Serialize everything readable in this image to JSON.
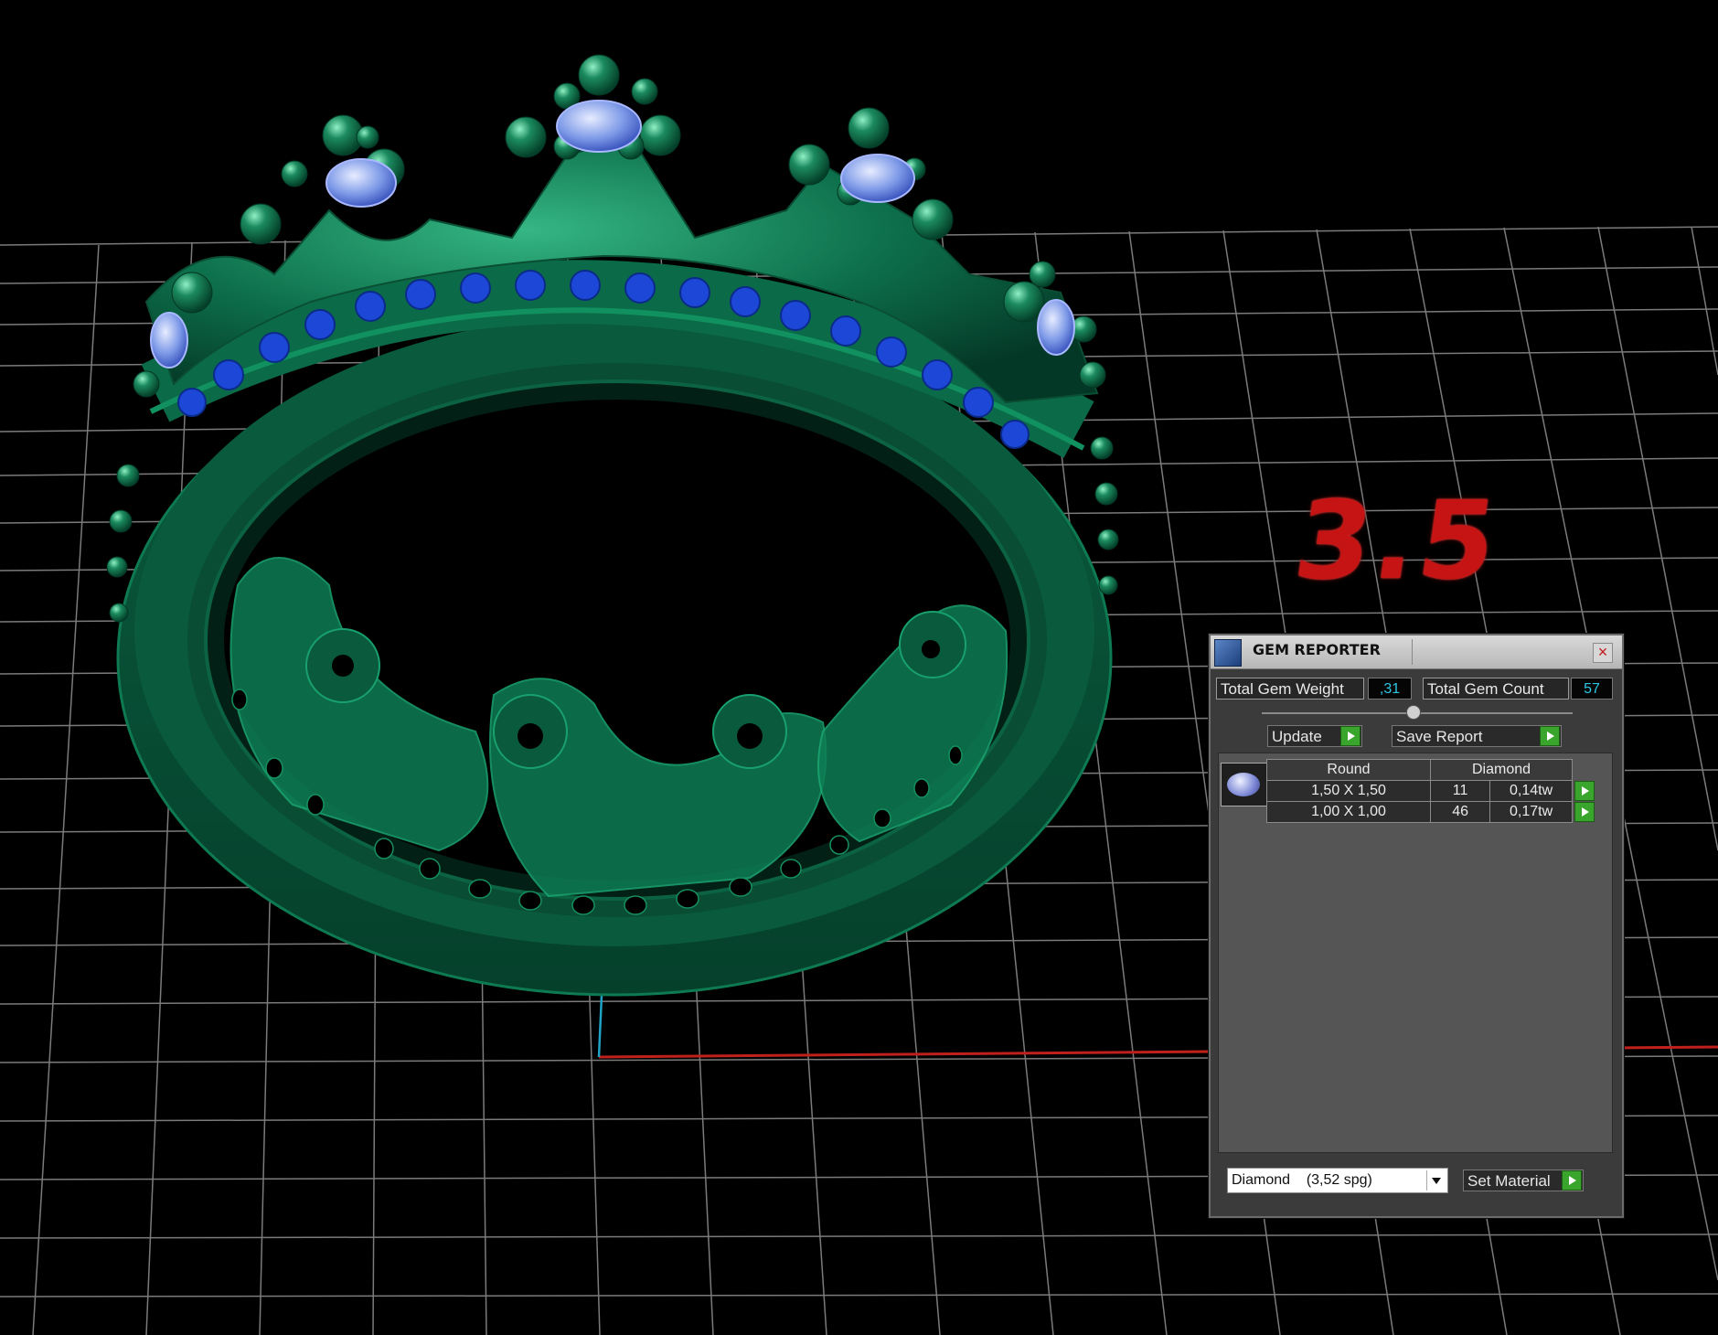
{
  "viewport": {
    "overlay_text": "3.5"
  },
  "gem_reporter": {
    "title": "GEM REPORTER",
    "total_gem_weight_label": "Total Gem Weight",
    "total_gem_weight_value": ",31",
    "total_gem_count_label": "Total Gem Count",
    "total_gem_count_value": "57",
    "update_label": "Update",
    "save_report_label": "Save Report",
    "table": {
      "headers": [
        "Round",
        "Diamond"
      ],
      "rows": [
        {
          "size": "1,50 X 1,50",
          "count": "11",
          "weight": "0,14tw"
        },
        {
          "size": "1,00 X 1,00",
          "count": "46",
          "weight": "0,17tw"
        }
      ]
    },
    "material_select_value": "Diamond    (3,52 spg)",
    "set_material_label": "Set Material",
    "icons": [
      "app-icon",
      "close-icon",
      "gem-icon",
      "arrow-right-icon",
      "chevron-down-icon"
    ]
  },
  "colors": {
    "ring": "#0e6b4a",
    "grid": "#7a7a7a",
    "overlay_text": "#c61313",
    "accent_cyan": "#2ec7e5",
    "go_button": "#3aa52d"
  }
}
